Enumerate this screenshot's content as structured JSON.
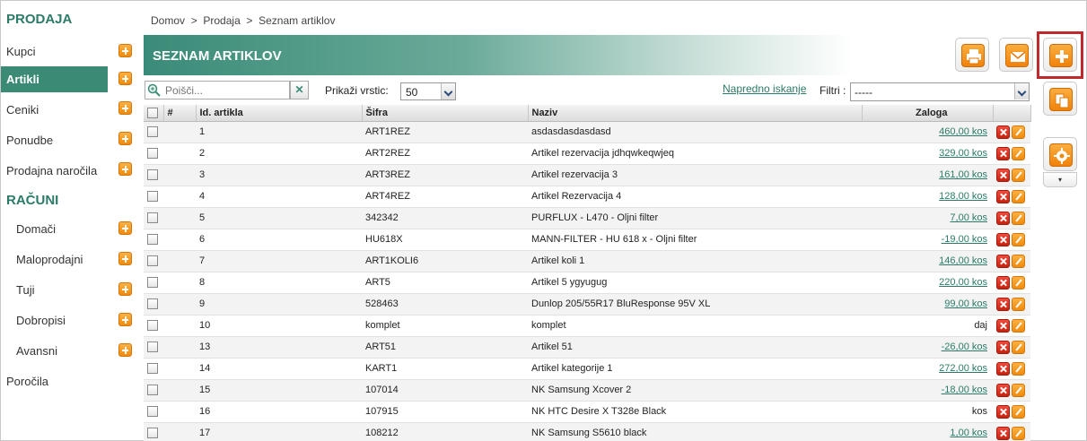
{
  "sidebar": {
    "section1": "PRODAJA",
    "section2": "RAČUNI",
    "items": [
      {
        "label": "Kupci"
      },
      {
        "label": "Artikli"
      },
      {
        "label": "Ceniki"
      },
      {
        "label": "Ponudbe"
      },
      {
        "label": "Prodajna naročila"
      },
      {
        "label": "Domači"
      },
      {
        "label": "Maloprodajni"
      },
      {
        "label": "Tuji"
      },
      {
        "label": "Dobropisi"
      },
      {
        "label": "Avansni"
      },
      {
        "label": "Poročila"
      }
    ],
    "active_item": "Artikli"
  },
  "breadcrumb": {
    "home": "Domov",
    "section": "Prodaja",
    "current": "Seznam artiklov",
    "separator": ">"
  },
  "header": {
    "title": "SEZNAM ARTIKLOV"
  },
  "toolbar": {
    "search_placeholder": "Poišči...",
    "clear_icon": "✕",
    "rows_label": "Prikaži vrstic:",
    "rows_value": "50",
    "advanced_search": "Napredno iskanje",
    "filter_label": "Filtri :",
    "filter_value": "-----"
  },
  "actions": {
    "icons": [
      "print-icon",
      "mail-icon",
      "add-icon",
      "copy-icon",
      "gear-icon"
    ],
    "caret": "▾"
  },
  "table": {
    "columns": [
      "#",
      "Id. artikla",
      "Šifra",
      "Naziv",
      "Zaloga"
    ],
    "rows": [
      {
        "id": "1",
        "code": "ART1REZ",
        "name": "asdasdasdasdasd",
        "stock": "460,00 kos",
        "link": true
      },
      {
        "id": "2",
        "code": "ART2REZ",
        "name": "Artikel rezervacija jdhqwkeqwjeq",
        "stock": "329,00 kos",
        "link": true
      },
      {
        "id": "3",
        "code": "ART3REZ",
        "name": "Artikel rezervacija 3",
        "stock": "161,00 kos",
        "link": true
      },
      {
        "id": "4",
        "code": "ART4REZ",
        "name": "Artikel Rezervacija 4",
        "stock": "128,00 kos",
        "link": true
      },
      {
        "id": "5",
        "code": "342342",
        "name": "PURFLUX - L470 - Oljni filter",
        "stock": "7,00 kos",
        "link": true
      },
      {
        "id": "6",
        "code": "HU618X",
        "name": "MANN-FILTER - HU 618 x - Oljni filter",
        "stock": "-19,00 kos",
        "link": true
      },
      {
        "id": "7",
        "code": "ART1KOLI6",
        "name": "Artikel koli 1",
        "stock": "146,00 kos",
        "link": true
      },
      {
        "id": "8",
        "code": "ART5",
        "name": "Artikel 5 ygyugug",
        "stock": "220,00 kos",
        "link": true
      },
      {
        "id": "9",
        "code": "528463",
        "name": "Dunlop 205/55R17 BluResponse 95V XL",
        "stock": "99,00 kos",
        "link": true
      },
      {
        "id": "10",
        "code": "komplet",
        "name": "komplet",
        "stock": "daj",
        "link": false
      },
      {
        "id": "13",
        "code": "ART51",
        "name": "Artikel 51",
        "stock": "-26,00 kos",
        "link": true
      },
      {
        "id": "14",
        "code": "KART1",
        "name": "Artikel kategorije 1",
        "stock": "272,00 kos",
        "link": true
      },
      {
        "id": "15",
        "code": "107014",
        "name": "NK Samsung Xcover 2",
        "stock": "-18,00 kos",
        "link": true
      },
      {
        "id": "16",
        "code": "107915",
        "name": "NK HTC Desire X T328e Black",
        "stock": "kos",
        "link": false
      },
      {
        "id": "17",
        "code": "108212",
        "name": "NK Samsung S5610 black",
        "stock": "1,00 kos",
        "link": true
      }
    ]
  }
}
